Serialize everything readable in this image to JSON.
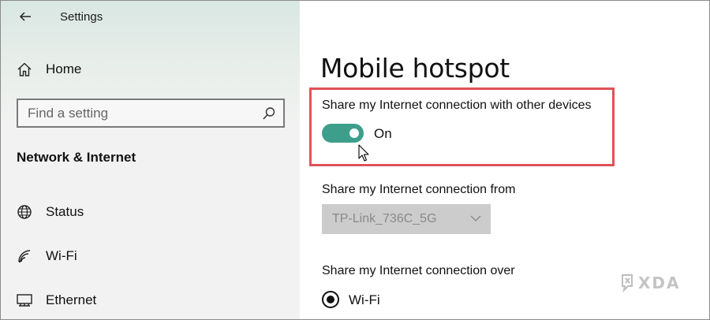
{
  "app": {
    "title": "Settings"
  },
  "sidebar": {
    "home_label": "Home",
    "search": {
      "placeholder": "Find a setting"
    },
    "section_title": "Network & Internet",
    "items": [
      {
        "label": "Status",
        "icon": "globe-icon"
      },
      {
        "label": "Wi-Fi",
        "icon": "wifi-icon"
      },
      {
        "label": "Ethernet",
        "icon": "ethernet-icon"
      }
    ]
  },
  "main": {
    "title": "Mobile hotspot",
    "share_setting": {
      "label": "Share my Internet connection with other devices",
      "toggle_state": "On"
    },
    "share_from": {
      "label": "Share my Internet connection from",
      "selected": "TP-Link_736C_5G"
    },
    "share_over": {
      "label": "Share my Internet connection over",
      "option": "Wi-Fi",
      "selected": true
    }
  },
  "watermark": {
    "text": "XDA"
  },
  "colors": {
    "accent": "#3e9e8c",
    "highlight": "#e05258",
    "sidebar_bg": "#f2f2f2"
  }
}
